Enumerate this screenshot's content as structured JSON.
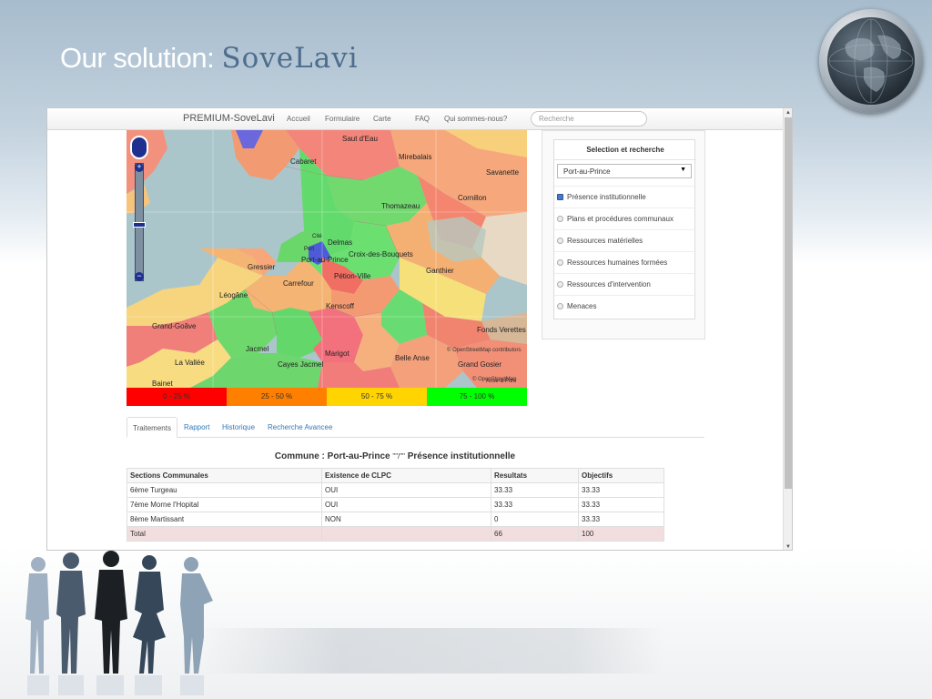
{
  "slide": {
    "title_prefix": "Our solution:",
    "title_brand": "SoveLavi"
  },
  "navbar": {
    "brand": "PREMIUM-SoveLavi",
    "links": [
      "Accueil",
      "Formulaire",
      "Carte",
      "FAQ",
      "Qui sommes-nous?"
    ],
    "search_placeholder": "Recherche"
  },
  "map": {
    "labels": {
      "saut_deau": "Saut d'Eau",
      "cabaret": "Cabaret",
      "mirebalais": "Mirebalais",
      "savanette": "Savanette",
      "cornillon": "Cornillon",
      "thomazeau": "Thomazeau",
      "delmas": "Delmas",
      "cite": "Cité",
      "port": "Port",
      "croix_des_bouquets": "Croix-des-Bouquets",
      "port_au_prince": "Port-au-Prince",
      "gressier": "Gressier",
      "petion_ville": "Pétion-Ville",
      "ganthier": "Ganthier",
      "carrefour": "Carrefour",
      "leogane": "Léogâne",
      "kenscoff": "Kenscoff",
      "grand_goave": "Grand-Goâve",
      "fonds_verettes": "Fonds Verettes",
      "jacmel": "Jacmel",
      "marigot": "Marigot",
      "la_vallee": "La Vallée",
      "cayes_jacmel": "Cayes Jacmel",
      "belle_anse": "Belle Anse",
      "grand_gosier": "Grand Gosier",
      "bainet": "Bainet",
      "anse_a_pitre": "Anse-à-Pitre"
    },
    "attribution": "© OpenStreetMap contributors",
    "copyright": "© OpenStreetMap"
  },
  "legend": [
    {
      "label": "0 - 25 %",
      "color": "#ff0000"
    },
    {
      "label": "25 - 50 %",
      "color": "#ff7f00"
    },
    {
      "label": "50 - 75 %",
      "color": "#ffd400"
    },
    {
      "label": "75 - 100 %",
      "color": "#00ff00"
    }
  ],
  "panel": {
    "title": "Selection et recherche",
    "selected_commune": "Port-au-Prince",
    "layers": [
      {
        "label": "Présence institutionnelle",
        "checked": true
      },
      {
        "label": "Plans et procédures communaux",
        "checked": false
      },
      {
        "label": "Ressources matérielles",
        "checked": false
      },
      {
        "label": "Ressources humaines formées",
        "checked": false
      },
      {
        "label": "Ressources d'intervention",
        "checked": false
      },
      {
        "label": "Menaces",
        "checked": false
      }
    ]
  },
  "tabs": [
    "Traitements",
    "Rapport",
    "Historique",
    "Recherche Avancee"
  ],
  "result": {
    "title": "Commune : Port-au-Prince",
    "marks": "\"\"/\"\"",
    "subject": "Présence institutionnelle",
    "headers": [
      "Sections Communales",
      "Existence de CLPC",
      "Resultats",
      "Objectifs"
    ],
    "rows": [
      [
        "6ème Turgeau",
        "OUI",
        "33.33",
        "33.33"
      ],
      [
        "7ème Morne l'Hopital",
        "OUI",
        "33.33",
        "33.33"
      ],
      [
        "8ème Martissant",
        "NON",
        "0",
        "33.33"
      ]
    ],
    "total": [
      "Total",
      "",
      "66",
      "100"
    ]
  }
}
